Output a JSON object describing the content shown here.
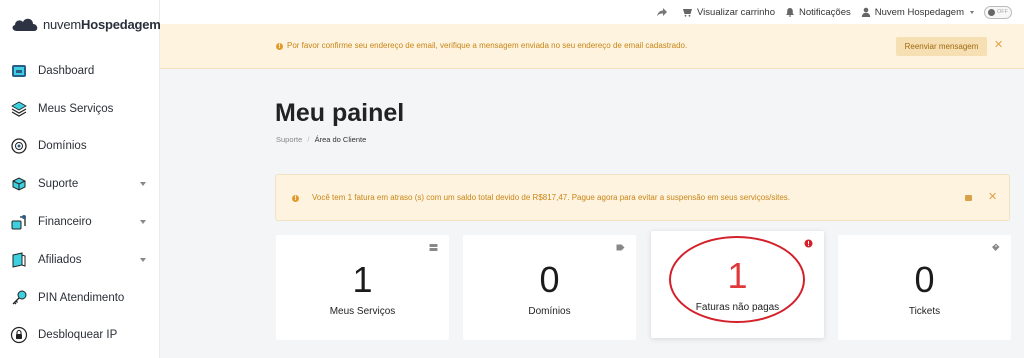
{
  "logo": {
    "light": "nuvem",
    "bold": "Hospedagem"
  },
  "sidebar": {
    "items": [
      {
        "label": "Dashboard",
        "icon": "dashboard-icon",
        "caret": false
      },
      {
        "label": "Meus Serviços",
        "icon": "services-icon",
        "caret": false
      },
      {
        "label": "Domínios",
        "icon": "domains-icon",
        "caret": false
      },
      {
        "label": "Suporte",
        "icon": "support-icon",
        "caret": true
      },
      {
        "label": "Financeiro",
        "icon": "finance-icon",
        "caret": true
      },
      {
        "label": "Afiliados",
        "icon": "affiliates-icon",
        "caret": true
      },
      {
        "label": "PIN Atendimento",
        "icon": "key-icon",
        "caret": false
      },
      {
        "label": "Desbloquear IP",
        "icon": "lock-icon",
        "caret": false
      }
    ]
  },
  "topbar": {
    "cart_label": "Visualizar carrinho",
    "notifications_label": "Notificações",
    "user_label": "Nuvem Hospedagem",
    "toggle_label": "OFF"
  },
  "email_alert": {
    "text": "Por favor confirme seu endereço de email, verifique a mensagem enviada no seu endereço de email cadastrado.",
    "button": "Reenviar mensagem"
  },
  "page": {
    "title": "Meu painel",
    "breadcrumb": {
      "link": "Suporte",
      "separator": "/",
      "current": "Área do Cliente"
    }
  },
  "overdue_alert": {
    "text": "Você tem 1 fatura em atraso (s) com um saldo total devido de R$817,47. Pague agora para evitar a suspensão em seus serviços/sites."
  },
  "cards": [
    {
      "value": "1",
      "label": "Meus Serviços",
      "icon": "server-icon"
    },
    {
      "value": "0",
      "label": "Domínios",
      "icon": "tag-icon"
    },
    {
      "value": "1",
      "label": "Faturas não pagas",
      "icon": "alert-icon"
    },
    {
      "value": "0",
      "label": "Tickets",
      "icon": "ticket-icon"
    }
  ],
  "colors": {
    "accent": "#e0393b",
    "warning": "#c98617",
    "warning_bg": "#fdf3df"
  }
}
